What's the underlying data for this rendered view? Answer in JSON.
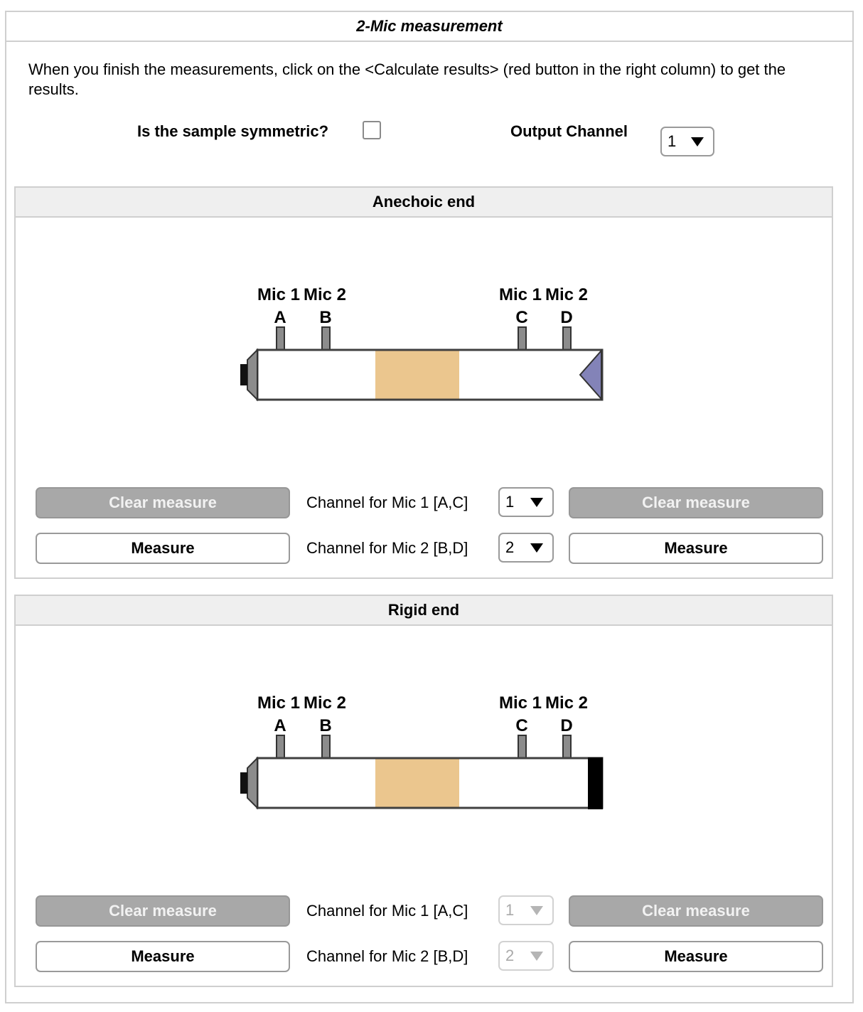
{
  "title": "2-Mic measurement",
  "intro": "When you finish the measurements, click on the <Calculate results> (red button in the right column) to get the results.",
  "symmetric": {
    "label": "Is the sample symmetric?",
    "checked": false
  },
  "output_channel": {
    "label": "Output Channel",
    "value": "1"
  },
  "mic_labels": {
    "mic1": "Mic 1",
    "mic2": "Mic 2",
    "a": "A",
    "b": "B",
    "c": "C",
    "d": "D"
  },
  "colors": {
    "sample": "#ebc68e",
    "anechoic_wedge": "#8383b8",
    "rigid_cap": "#000000",
    "speaker": "#8c8c8c"
  },
  "anechoic": {
    "header": "Anechoic end",
    "clear_left": "Clear measure",
    "clear_right": "Clear measure",
    "measure_left": "Measure",
    "measure_right": "Measure",
    "ch1_label": "Channel for Mic 1 [A,C]",
    "ch1_value": "1",
    "ch2_label": "Channel for Mic 2 [B,D]",
    "ch2_value": "2"
  },
  "rigid": {
    "header": "Rigid end",
    "clear_left": "Clear measure",
    "clear_right": "Clear measure",
    "measure_left": "Measure",
    "measure_right": "Measure",
    "ch1_label": "Channel for Mic 1 [A,C]",
    "ch1_value": "1",
    "ch2_label": "Channel for Mic 2 [B,D]",
    "ch2_value": "2"
  }
}
